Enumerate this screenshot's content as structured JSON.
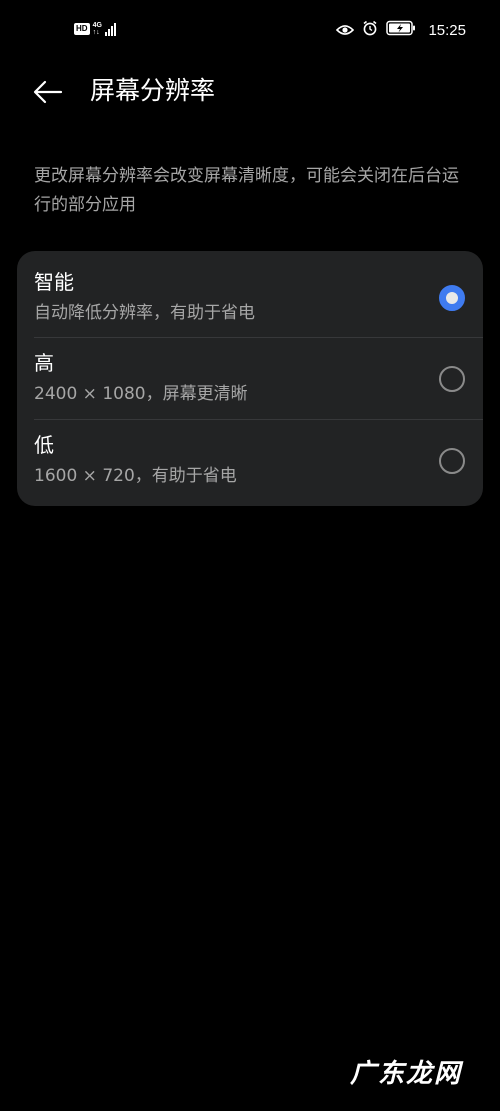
{
  "status_bar": {
    "hd_label": "HD",
    "network_top": "4G",
    "network_bottom": "↑↓",
    "time": "15:25"
  },
  "header": {
    "title": "屏幕分辨率",
    "back_icon": "arrow-left-icon"
  },
  "description": "更改屏幕分辨率会改变屏幕清晰度，可能会关闭在后台运行的部分应用",
  "options": [
    {
      "title": "智能",
      "subtitle": "自动降低分辨率，有助于省电",
      "selected": true
    },
    {
      "title": "高",
      "subtitle": "2400 × 1080，屏幕更清晰",
      "selected": false
    },
    {
      "title": "低",
      "subtitle": "1600 × 720，有助于省电",
      "selected": false
    }
  ],
  "watermark": "广东龙网",
  "colors": {
    "background": "#000000",
    "card": "#222324",
    "accent": "#3f7bf0",
    "secondary_text": "#a6a6a6"
  }
}
